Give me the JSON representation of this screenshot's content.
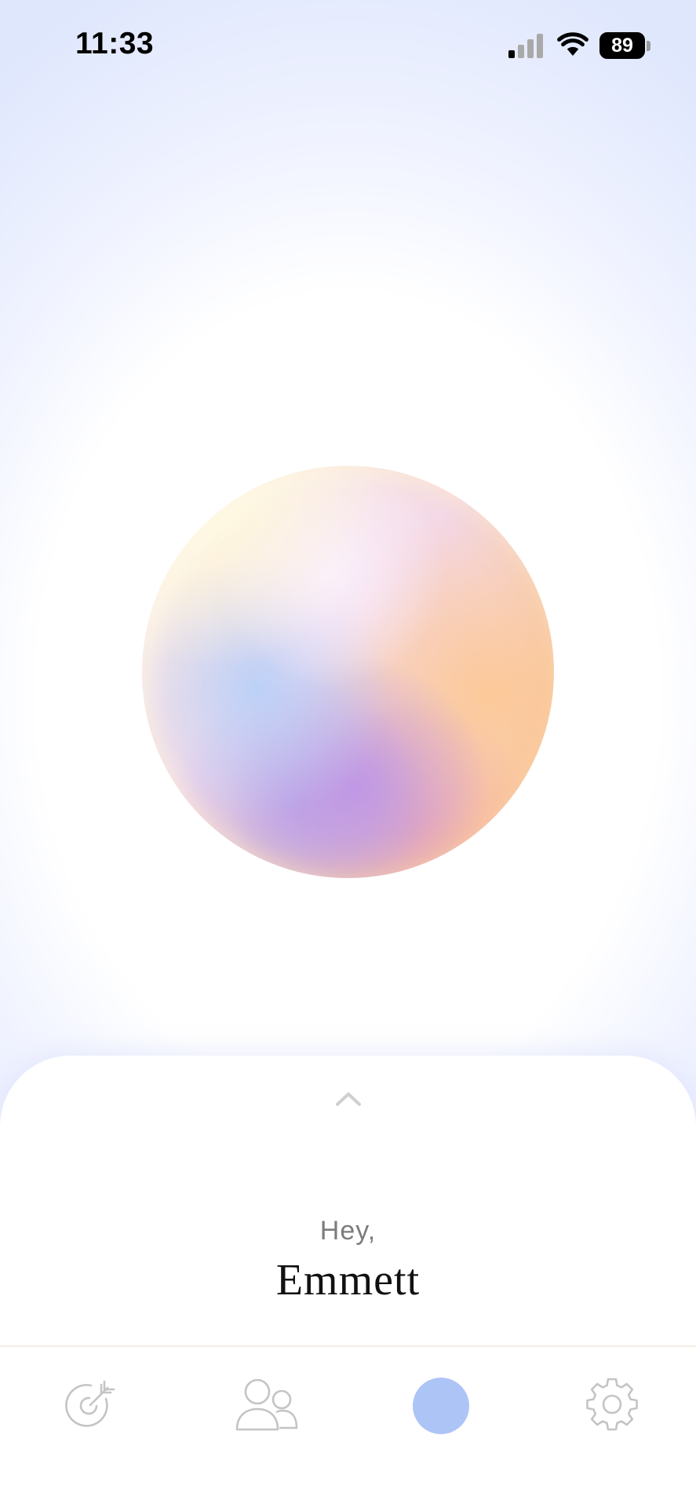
{
  "status_bar": {
    "time": "11:33",
    "battery_level": "89",
    "icons": [
      "signal-icon",
      "wifi-icon",
      "battery-icon"
    ]
  },
  "sheet": {
    "handle_icon": "chevron-up-icon",
    "greeting": "Hey,",
    "user_name": "Emmett"
  },
  "tab_bar": {
    "tabs": [
      {
        "icon": "goal-icon",
        "active": false
      },
      {
        "icon": "people-icon",
        "active": false
      },
      {
        "icon": "home-orb-icon",
        "active": true
      },
      {
        "icon": "gear-icon",
        "active": false
      }
    ]
  },
  "colors": {
    "background_top": "#dfe7fd",
    "active_tab": "#adc4f6",
    "inactive_icon": "#c4c4c4",
    "name_text": "#111111",
    "greeting_text": "#7c7c7c"
  }
}
